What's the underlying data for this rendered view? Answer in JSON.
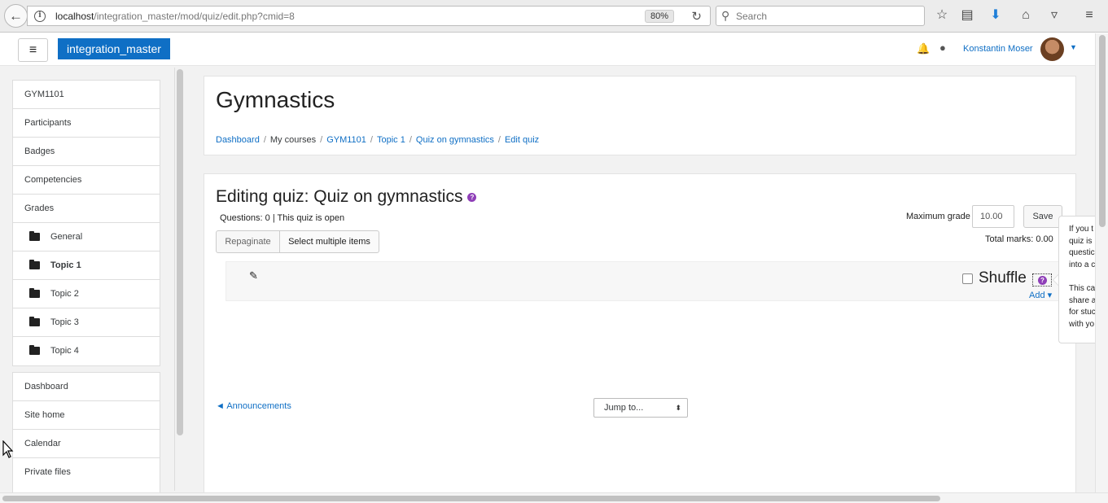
{
  "browser": {
    "url_host": "localhost",
    "url_path": "/integration_master/mod/quiz/edit.php?cmid=8",
    "zoom": "80%",
    "search_placeholder": "Search"
  },
  "navbar": {
    "site_name": "integration_master",
    "user_name": "Konstantin Moser"
  },
  "drawer": {
    "course_items": [
      {
        "label": "GYM1101",
        "indent": false
      },
      {
        "label": "Participants",
        "indent": false
      },
      {
        "label": "Badges",
        "indent": false
      },
      {
        "label": "Competencies",
        "indent": false
      },
      {
        "label": "Grades",
        "indent": false
      },
      {
        "label": "General",
        "indent": true
      },
      {
        "label": "Topic 1",
        "indent": true,
        "active": true
      },
      {
        "label": "Topic 2",
        "indent": true
      },
      {
        "label": "Topic 3",
        "indent": true
      },
      {
        "label": "Topic 4",
        "indent": true
      }
    ],
    "site_items": [
      {
        "label": "Dashboard"
      },
      {
        "label": "Site home"
      },
      {
        "label": "Calendar"
      },
      {
        "label": "Private files"
      }
    ]
  },
  "header": {
    "course_title": "Gymnastics",
    "breadcrumb": [
      {
        "label": "Dashboard",
        "link": true
      },
      {
        "label": "My courses",
        "link": false
      },
      {
        "label": "GYM1101",
        "link": true
      },
      {
        "label": "Topic 1",
        "link": true
      },
      {
        "label": "Quiz on gymnastics",
        "link": true
      },
      {
        "label": "Edit quiz",
        "link": true
      }
    ]
  },
  "quiz": {
    "title": "Editing quiz: Quiz on gymnastics",
    "status": "Questions: 0 | This quiz is open",
    "repaginate_label": "Repaginate",
    "select_multiple_label": "Select multiple items",
    "max_grade_label": "Maximum grade",
    "max_grade_value": "10.00",
    "save_label": "Save",
    "total_marks": "Total marks: 0.00",
    "shuffle_label": "Shuffle",
    "add_label": "Add ▾",
    "prev_activity": "◄ Announcements",
    "jump_to": "Jump to..."
  },
  "popover": {
    "text": "If you t\nquiz is\nquestic\ninto a c\n\nThis ca\nshare a\nfor stuc\nwith yo"
  },
  "colors": {
    "brand": "#0f6fc5",
    "help_icon": "#8f3fb8",
    "page_bg": "#f2f2f2"
  }
}
